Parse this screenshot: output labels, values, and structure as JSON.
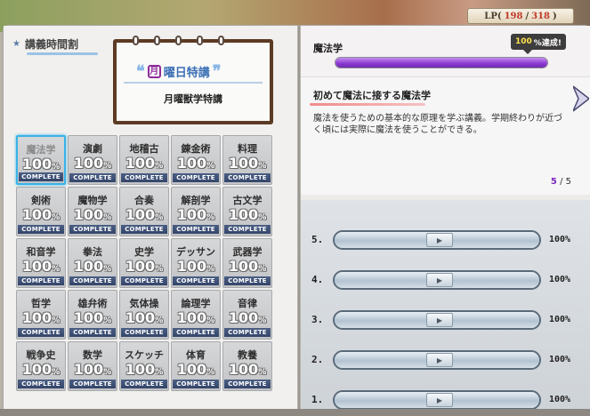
{
  "status_bar": {
    "lp_label": "LP(",
    "lp_current": "198",
    "lp_sep": "/",
    "lp_max": "318",
    "lp_close": ")"
  },
  "schedule": {
    "title": "講義時間割",
    "card": {
      "day_badge": "月",
      "day_heading": "曜日特講",
      "subtitle": "月曜獣学特講"
    },
    "tiles": [
      {
        "name": "魔法学",
        "pct": "100",
        "unit": "%",
        "status": "COMPLETE",
        "selected": true
      },
      {
        "name": "演劇",
        "pct": "100",
        "unit": "%",
        "status": "COMPLETE"
      },
      {
        "name": "地稽古",
        "pct": "100",
        "unit": "%",
        "status": "COMPLETE"
      },
      {
        "name": "錬金術",
        "pct": "100",
        "unit": "%",
        "status": "COMPLETE"
      },
      {
        "name": "料理",
        "pct": "100",
        "unit": "%",
        "status": "COMPLETE"
      },
      {
        "name": "剣術",
        "pct": "100",
        "unit": "%",
        "status": "COMPLETE"
      },
      {
        "name": "魔物学",
        "pct": "100",
        "unit": "%",
        "status": "COMPLETE"
      },
      {
        "name": "合奏",
        "pct": "100",
        "unit": "%",
        "status": "COMPLETE"
      },
      {
        "name": "解剖学",
        "pct": "100",
        "unit": "%",
        "status": "COMPLETE"
      },
      {
        "name": "古文学",
        "pct": "100",
        "unit": "%",
        "status": "COMPLETE"
      },
      {
        "name": "和音学",
        "pct": "100",
        "unit": "%",
        "status": "COMPLETE"
      },
      {
        "name": "拳法",
        "pct": "100",
        "unit": "%",
        "status": "COMPLETE"
      },
      {
        "name": "史学",
        "pct": "100",
        "unit": "%",
        "status": "COMPLETE"
      },
      {
        "name": "デッサン",
        "pct": "100",
        "unit": "%",
        "status": "COMPLETE"
      },
      {
        "name": "武器学",
        "pct": "100",
        "unit": "%",
        "status": "COMPLETE"
      },
      {
        "name": "哲学",
        "pct": "100",
        "unit": "%",
        "status": "COMPLETE"
      },
      {
        "name": "雄弁術",
        "pct": "100",
        "unit": "%",
        "status": "COMPLETE"
      },
      {
        "name": "気体操",
        "pct": "100",
        "unit": "%",
        "status": "COMPLETE"
      },
      {
        "name": "論理学",
        "pct": "100",
        "unit": "%",
        "status": "COMPLETE"
      },
      {
        "name": "音律",
        "pct": "100",
        "unit": "%",
        "status": "COMPLETE"
      },
      {
        "name": "戦争史",
        "pct": "100",
        "unit": "%",
        "status": "COMPLETE"
      },
      {
        "name": "数学",
        "pct": "100",
        "unit": "%",
        "status": "COMPLETE"
      },
      {
        "name": "スケッチ",
        "pct": "100",
        "unit": "%",
        "status": "COMPLETE"
      },
      {
        "name": "体育",
        "pct": "100",
        "unit": "%",
        "status": "COMPLETE"
      },
      {
        "name": "教養",
        "pct": "100",
        "unit": "%",
        "status": "COMPLETE"
      }
    ]
  },
  "detail": {
    "subject": "魔法学",
    "achievement_pct": "100",
    "achievement_suffix": "%達成!",
    "progress_fraction": 1.0,
    "lesson_title": "初めて魔法に接する魔法学",
    "lesson_body": "魔法を使うための基本的な原理を学ぶ講義。学期終わりが近づく頃には実際に魔法を使うことができる。",
    "page_current": "5",
    "page_sep": "/",
    "page_total": "5"
  },
  "practice": [
    {
      "label": "5.",
      "pct": "100%",
      "fill": 1.0,
      "button": "▶"
    },
    {
      "label": "4.",
      "pct": "100%",
      "fill": 1.0,
      "button": "▶"
    },
    {
      "label": "3.",
      "pct": "100%",
      "fill": 1.0,
      "button": "▶"
    },
    {
      "label": "2.",
      "pct": "100%",
      "fill": 1.0,
      "button": "▶"
    },
    {
      "label": "1.",
      "pct": "100%",
      "fill": 1.0,
      "button": "▶"
    }
  ],
  "colors": {
    "selected_border": "#39b2e6",
    "progress_purple": "#8a38d1",
    "complete_band": "#34456a",
    "lp_value": "#c0392b"
  }
}
